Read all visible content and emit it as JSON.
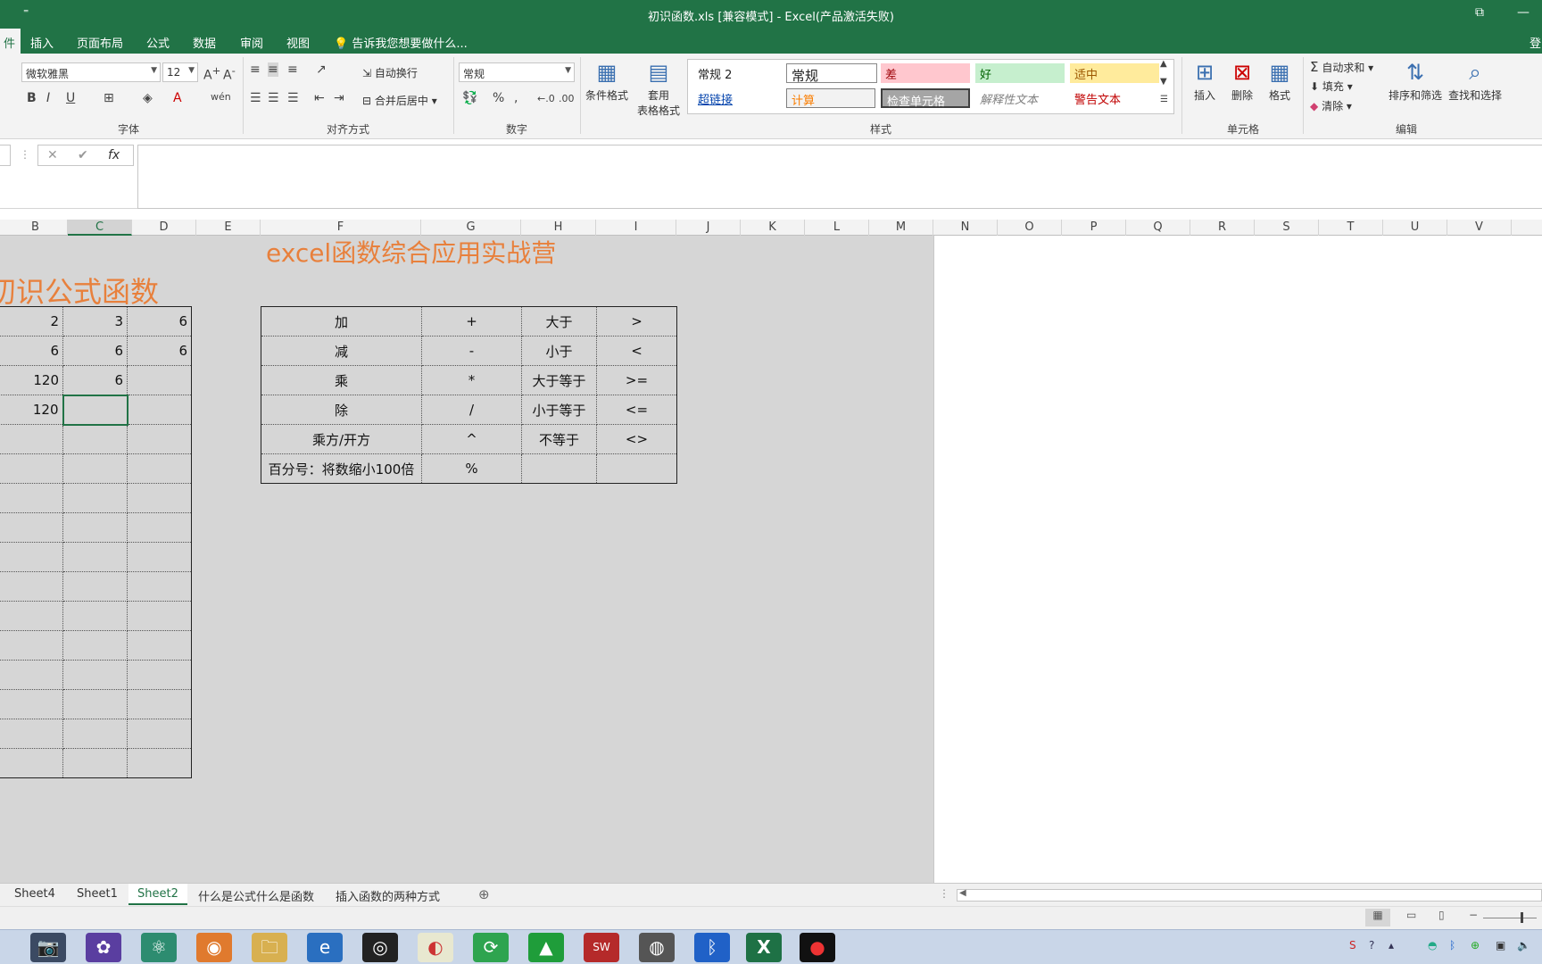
{
  "window": {
    "title": "初识函数.xls  [兼容模式] - Excel(产品激活失败)",
    "quick_access": "⁼",
    "login": "登"
  },
  "tabs": [
    "件",
    "插入",
    "页面布局",
    "公式",
    "数据",
    "审阅",
    "视图"
  ],
  "tell_me": "告诉我您想要做什么...",
  "ribbon": {
    "font_name": "微软雅黑",
    "font_size": "12",
    "wrap_text": "自动换行",
    "merge_center": "合并后居中",
    "number_format": "常规",
    "conditional_format": "条件格式",
    "table_format_1": "套用",
    "table_format_2": "表格格式",
    "styles": {
      "normal2": "常规 2",
      "normal": "常规",
      "bad": "差",
      "good": "好",
      "neutral": "适中",
      "hyperlink": "超链接",
      "calc": "计算",
      "check": "检查单元格",
      "explain": "解释性文本",
      "warn": "警告文本"
    },
    "insert": "插入",
    "delete": "删除",
    "format": "格式",
    "autosum": "自动求和",
    "fill": "填充",
    "clear": "清除",
    "sort_filter": "排序和筛选",
    "find_select": "查找和选择",
    "groups": {
      "font": "字体",
      "align": "对齐方式",
      "number": "数字",
      "styles": "样式",
      "cells": "单元格",
      "edit": "编辑"
    },
    "colors": {
      "accent": "#217346",
      "title_orange": "#e8803c"
    }
  },
  "formula_bar": {
    "fx": "fx",
    "cancel": "✕",
    "enter": "✔"
  },
  "columns": [
    "B",
    "C",
    "D",
    "E",
    "F",
    "G",
    "H",
    "I",
    "J",
    "K",
    "L",
    "M",
    "N",
    "O",
    "P",
    "Q",
    "R",
    "S",
    "T",
    "U",
    "V"
  ],
  "selected_column": "C",
  "sheet": {
    "title_top": "excel函数综合应用实战营",
    "title_left": "初识公式函数",
    "left_table": [
      [
        "2",
        "3",
        "6"
      ],
      [
        "6",
        "6",
        "6"
      ],
      [
        "120",
        "6",
        ""
      ],
      [
        "120",
        "",
        ""
      ]
    ],
    "right_table": [
      [
        "加",
        "+",
        "大于",
        ">"
      ],
      [
        "减",
        "-",
        "小于",
        "<"
      ],
      [
        "乘",
        "*",
        "大于等于",
        ">="
      ],
      [
        "除",
        "/",
        "小于等于",
        "<="
      ],
      [
        "乘方/开方",
        "^",
        "不等于",
        "<>"
      ],
      [
        "百分号：将数缩小100倍",
        "%",
        "",
        ""
      ]
    ]
  },
  "sheet_tabs": [
    "Sheet4",
    "Sheet1",
    "Sheet2",
    "什么是公式什么是函数",
    "插入函数的两种方式"
  ],
  "active_sheet": "Sheet2"
}
